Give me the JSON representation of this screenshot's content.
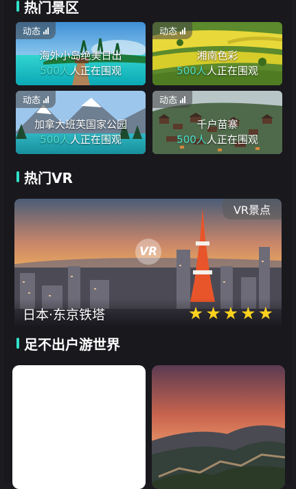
{
  "sections": {
    "hot_spots_title": "热门景区",
    "hot_vr_title": "热门VR",
    "world_title": "足不出户游世界"
  },
  "scenic_cards": [
    {
      "tag": "动态",
      "name": "海外小岛绝美日出",
      "viewers_num": "500人",
      "viewers_text": "人正在围观"
    },
    {
      "tag": "动态",
      "name": "湘南色彩",
      "viewers_num": "500人",
      "viewers_text": "人正在围观"
    },
    {
      "tag": "动态",
      "name": "加拿大班芙国家公园",
      "viewers_num": "500人",
      "viewers_text": "人正在围观"
    },
    {
      "tag": "动态",
      "name": "千户苗寨",
      "viewers_num": "500人",
      "viewers_text": "人正在围观"
    }
  ],
  "vr_card": {
    "badge": "VR景点",
    "logo": "VR",
    "place": "日本·东京铁塔",
    "rating": 5
  },
  "icons": {
    "signal": "signal-bars-icon",
    "star": "star-icon",
    "section_marker": "accent-bar"
  },
  "colors": {
    "accent": "#2fe0c9",
    "viewers_highlight": "#4fe0d0",
    "star": "#ffd21e",
    "background": "#19181d"
  }
}
